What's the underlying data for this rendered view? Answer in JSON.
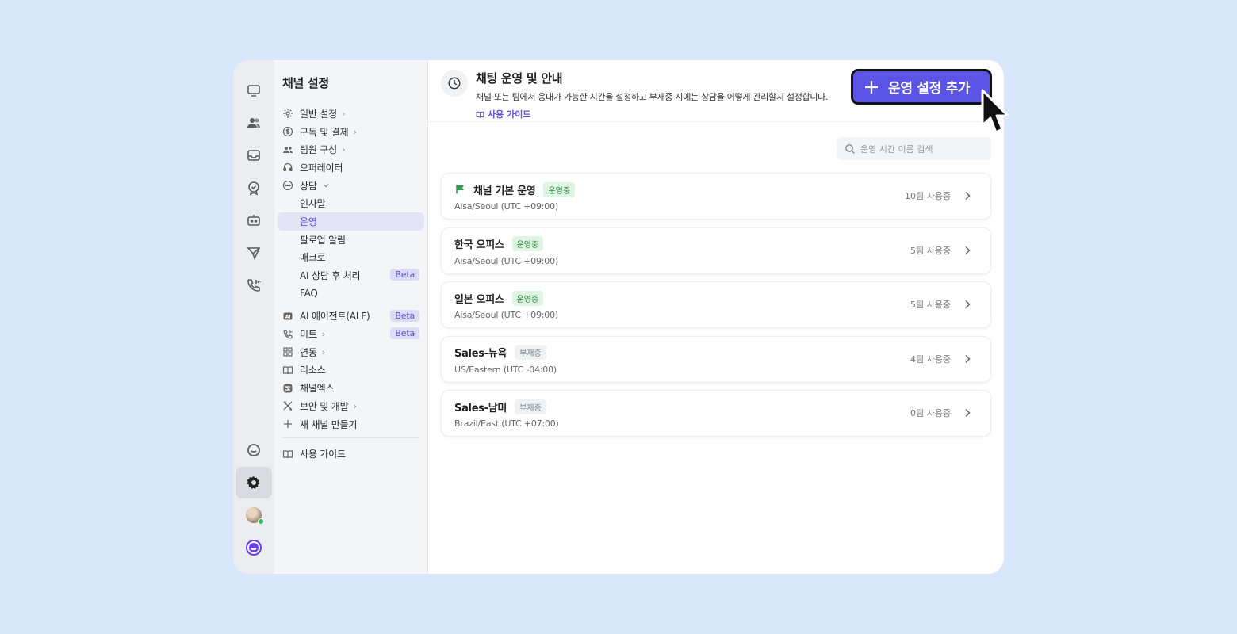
{
  "sidebar": {
    "title": "채널 설정",
    "items": [
      {
        "label": "일반 설정",
        "icon": "gear-icon",
        "chevron": true
      },
      {
        "label": "구독 및 결제",
        "icon": "dollar-icon",
        "chevron": true
      },
      {
        "label": "팀원 구성",
        "icon": "users-icon",
        "chevron": true
      },
      {
        "label": "오퍼레이터",
        "icon": "headset-icon"
      },
      {
        "label": "상담",
        "icon": "chat-icon",
        "chevron_down": true
      }
    ],
    "sub_items": [
      "인사말",
      "운영",
      "팔로업 알림",
      "매크로",
      "AI 상담 후 처리",
      "FAQ"
    ],
    "items2": [
      {
        "label": "AI 에이전트(ALF)",
        "icon": "ai-icon",
        "beta": true
      },
      {
        "label": "미트",
        "icon": "phone-icon",
        "chevron": true,
        "beta": true
      },
      {
        "label": "연동",
        "icon": "grid-icon",
        "chevron": true
      },
      {
        "label": "리소스",
        "icon": "book-icon"
      },
      {
        "label": "채널엑스",
        "icon": "channelx-icon"
      },
      {
        "label": "보안 및 개발",
        "icon": "tools-icon",
        "chevron": true
      },
      {
        "label": "새 채널 만들기",
        "icon": "plus-icon"
      }
    ],
    "guide": "사용 가이드",
    "beta_label": "Beta"
  },
  "header": {
    "title": "채팅 운영 및 안내",
    "desc": "채널 또는 팀에서 응대가 가능한 시간을 설정하고 부재중 시에는 상담을 어떻게 관리할지 설정합니다.",
    "guide_link": "사용 가이드",
    "add_button": "운영 설정 추가"
  },
  "search": {
    "placeholder": "운영 시간 이름 검색"
  },
  "cards": [
    {
      "name": "채널 기본 운영",
      "status": "운영중",
      "active": true,
      "tz": "Aisa/Seoul (UTC +09:00)",
      "teams": "10팀 사용중",
      "flag": true
    },
    {
      "name": "한국 오피스",
      "status": "운영중",
      "active": true,
      "tz": "Aisa/Seoul (UTC +09:00)",
      "teams": "5팀 사용중"
    },
    {
      "name": "일본 오피스",
      "status": "운영중",
      "active": true,
      "tz": "Aisa/Seoul (UTC +09:00)",
      "teams": "5팀 사용중"
    },
    {
      "name": "Sales-뉴욕",
      "status": "부재중",
      "active": false,
      "tz": "US/Eastern (UTC -04:00)",
      "teams": "4팀 사용중"
    },
    {
      "name": "Sales-남미",
      "status": "부재중",
      "active": false,
      "tz": "Brazil/East (UTC +07:00)",
      "teams": "0팀 사용중"
    }
  ],
  "colors": {
    "accent": "#5b54e6",
    "active_status": "#2f8a45",
    "background": "#d9e7fd"
  }
}
